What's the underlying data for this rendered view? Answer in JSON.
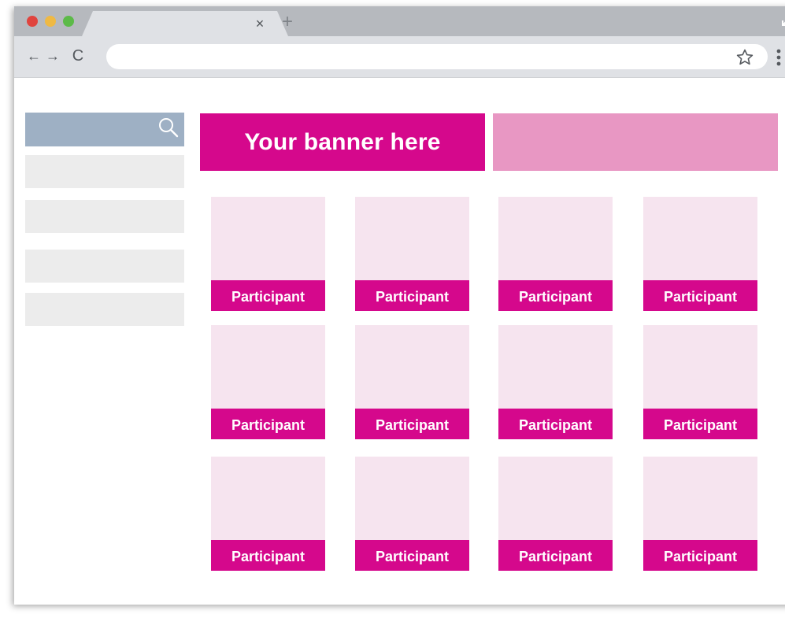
{
  "browser": {
    "tab_close": "×",
    "new_tab": "+",
    "nav_back": "←",
    "nav_forward": "→",
    "nav_reload": "C",
    "address_value": ""
  },
  "colors": {
    "accent": "#d5088c",
    "accent_light": "#e897c3",
    "card_bg": "#f6e4ef",
    "search_bg": "#9eb0c4",
    "sidebar_item_bg": "#ececec"
  },
  "sidebar": {
    "search_placeholder": "",
    "items": [
      "",
      "",
      "",
      ""
    ]
  },
  "banner": {
    "primary_text": "Your banner here",
    "secondary_text": ""
  },
  "grid": {
    "cards": [
      {
        "label": "Participant"
      },
      {
        "label": "Participant"
      },
      {
        "label": "Participant"
      },
      {
        "label": "Participant"
      },
      {
        "label": "Participant"
      },
      {
        "label": "Participant"
      },
      {
        "label": "Participant"
      },
      {
        "label": "Participant"
      },
      {
        "label": "Participant"
      },
      {
        "label": "Participant"
      },
      {
        "label": "Participant"
      },
      {
        "label": "Participant"
      }
    ]
  }
}
